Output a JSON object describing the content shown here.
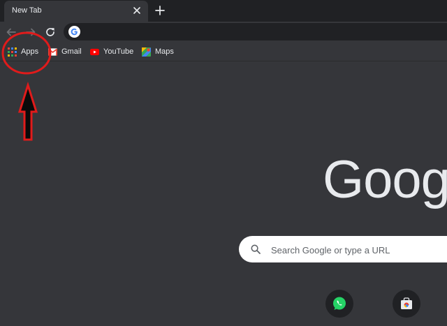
{
  "tab": {
    "title": "New Tab"
  },
  "omnibox": {
    "value": "",
    "placeholder": ""
  },
  "bookmarks": [
    {
      "label": "Apps",
      "icon": "apps-grid-icon"
    },
    {
      "label": "Gmail",
      "icon": "gmail-icon"
    },
    {
      "label": "YouTube",
      "icon": "youtube-icon"
    },
    {
      "label": "Maps",
      "icon": "maps-icon"
    }
  ],
  "logo": {
    "text": "Goog"
  },
  "search": {
    "placeholder": "Search Google or type a URL"
  },
  "shortcuts": [
    {
      "icon": "whatsapp-icon"
    },
    {
      "icon": "web-store-icon"
    }
  ],
  "colors": {
    "tabstrip": "#202124",
    "toolbar": "#35363a",
    "page_background": "#35363a",
    "annotation_red": "#e01b1b"
  }
}
